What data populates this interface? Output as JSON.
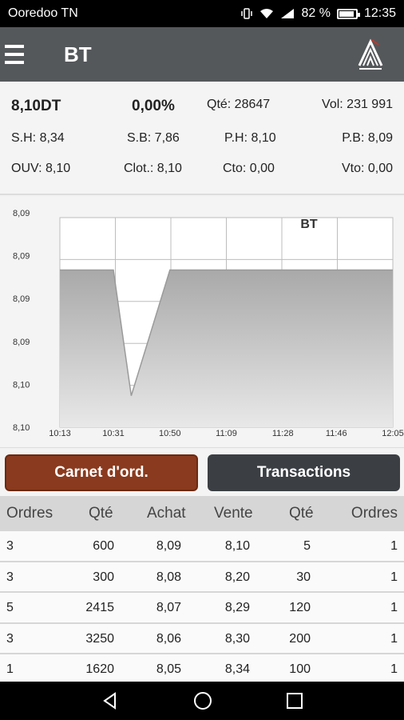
{
  "status_bar": {
    "carrier": "Ooredoo TN",
    "battery": "82 %",
    "time": "12:35",
    "network": "4G"
  },
  "app_bar": {
    "title": "BT"
  },
  "quote": {
    "price": "8,10DT",
    "change": "0,00%",
    "qty": "Qté: 28647",
    "vol": "Vol: 231 991",
    "sh": "S.H: 8,34",
    "sb": "S.B: 7,86",
    "ph": "P.H: 8,10",
    "pb": "P.B: 8,09",
    "ouv": "OUV: 8,10",
    "clot": "Clot.: 8,10",
    "cto": "Cto: 0,00",
    "vto": "Vto: 0,00"
  },
  "chart_data": {
    "type": "area",
    "title": "BT",
    "y_tick_labels": [
      "8,09",
      "8,09",
      "8,09",
      "8,09",
      "8,10",
      "8,10"
    ],
    "x_tick_labels": [
      "10:13",
      "10:31",
      "10:50",
      "11:09",
      "11:28",
      "11:46",
      "12:05"
    ],
    "x": [
      "10:13",
      "10:31",
      "10:37",
      "10:50",
      "11:09",
      "12:05"
    ],
    "y": [
      8.095,
      8.095,
      8.101,
      8.095,
      8.095,
      8.095
    ],
    "y_reversed": true,
    "grid": true,
    "fill_color": "#b8b8b8"
  },
  "buttons": {
    "carnet": "Carnet d'ord.",
    "transactions": "Transactions"
  },
  "order_book": {
    "headers": [
      "Ordres",
      "Qté",
      "Achat",
      "Vente",
      "Qté",
      "Ordres"
    ],
    "rows": [
      [
        "3",
        "600",
        "8,09",
        "8,10",
        "5",
        "1"
      ],
      [
        "3",
        "300",
        "8,08",
        "8,20",
        "30",
        "1"
      ],
      [
        "5",
        "2415",
        "8,07",
        "8,29",
        "120",
        "1"
      ],
      [
        "3",
        "3250",
        "8,06",
        "8,30",
        "200",
        "1"
      ],
      [
        "1",
        "1620",
        "8,05",
        "8,34",
        "100",
        "1"
      ]
    ]
  },
  "colors": {
    "app_bar": "#55585b",
    "carnet_button": "#8a3a1e",
    "transactions_button": "#3b3f44",
    "table_header": "#d6d6d6"
  },
  "nav_icons": [
    "back-icon",
    "home-icon",
    "recents-icon"
  ]
}
